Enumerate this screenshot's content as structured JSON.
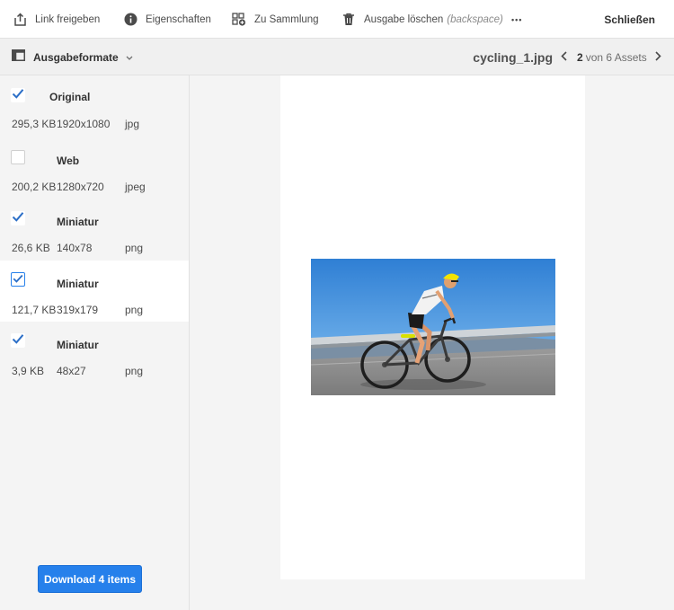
{
  "toolbar": {
    "link_label": "Link freigeben",
    "properties_label": "Eigenschaften",
    "collection_label": "Zu Sammlung",
    "delete_label": "Ausgabe löschen",
    "delete_hint": "(backspace)",
    "more_label": "•••",
    "close_label": "Schließen"
  },
  "subbar": {
    "rail_label": "Ausgabeformate",
    "asset_title": "cycling_1.jpg",
    "pager_current": "2",
    "pager_rest": "von 6 Assets"
  },
  "renditions": [
    {
      "name": "Original",
      "size": "295,3 KB",
      "dimensions": "1920x1080",
      "format": "jpg",
      "checked": true
    },
    {
      "name": "Web",
      "size": "200,2 KB",
      "dimensions": "1280x720",
      "format": "jpeg",
      "checked": false
    },
    {
      "name": "Miniatur",
      "size": "26,6 KB",
      "dimensions": "140x78",
      "format": "png",
      "checked": true
    },
    {
      "name": "Miniatur",
      "size": "121,7 KB",
      "dimensions": "319x179",
      "format": "png",
      "checked": true,
      "active": true
    },
    {
      "name": "Miniatur",
      "size": "3,9 KB",
      "dimensions": "48x27",
      "format": "png",
      "checked": true
    }
  ],
  "download_label": "Download 4 items",
  "colors": {
    "accent": "#2680eb",
    "checkmark": "#2c6fc7"
  }
}
